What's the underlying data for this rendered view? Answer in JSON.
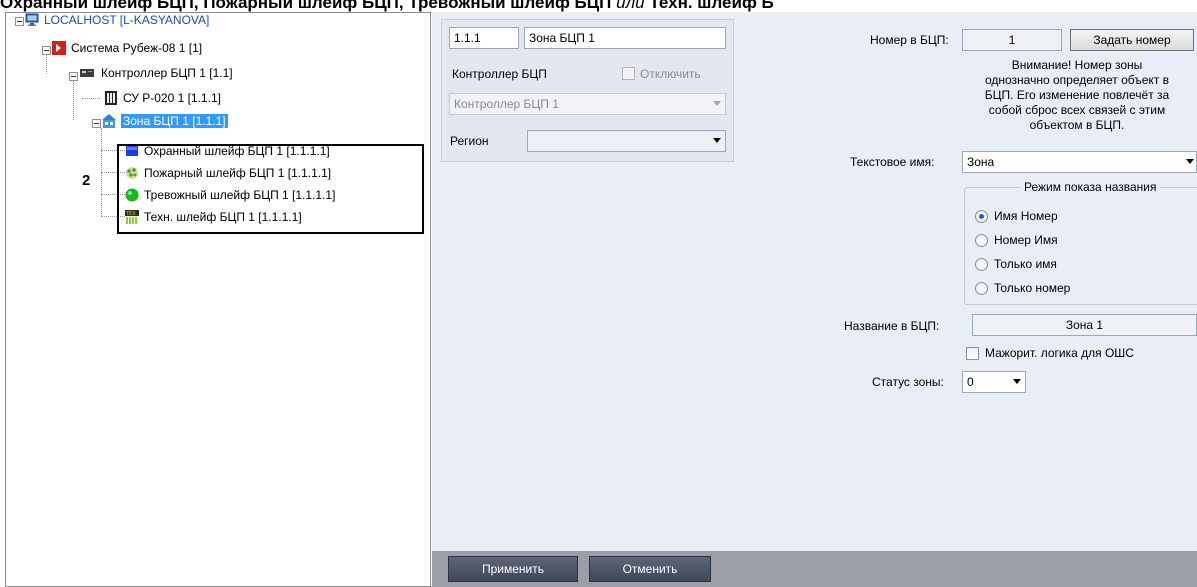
{
  "heading": {
    "part1": "Охранный шлейф БЦП",
    "sep1": ", ",
    "part2": "Пожарный шлейф БЦП",
    "sep2": ", ",
    "part3": "Тревожный шлейф БЦП",
    "sep3": " или ",
    "part4": "Техн. шлейф Б"
  },
  "tree": {
    "root": "LOCALHOST [L-KASYANOVA]",
    "system": "Система Рубеж-08 1 [1]",
    "controller": "Контроллер БЦП 1 [1.1]",
    "su": "СУ Р-020 1 [1.1.1]",
    "zone": "Зона БЦП 1 [1.1.1]",
    "loops": [
      {
        "label": "Охранный шлейф БЦП 1 [1.1.1.1]",
        "icon": "security-loop-icon"
      },
      {
        "label": "Пожарный шлейф БЦП 1 [1.1.1.1]",
        "icon": "fire-loop-icon"
      },
      {
        "label": "Тревожный шлейф БЦП 1 [1.1.1.1]",
        "icon": "alarm-loop-icon"
      },
      {
        "label": "Техн. шлейф БЦП 1 [1.1.1.1]",
        "icon": "tech-loop-icon"
      }
    ],
    "annotation": "2"
  },
  "form": {
    "id_value": "1.1.1",
    "name_value": "Зона БЦП 1",
    "controller_label": "Контроллер БЦП",
    "disable_label": "Отключить",
    "controller_value": "Контроллер БЦП 1",
    "region_label": "Регион",
    "region_value": "",
    "number_label": "Номер в БЦП:",
    "number_value": "1",
    "set_number_button": "Задать номер",
    "warning": [
      "Внимание! Номер зоны",
      "однозначно определяет объект в",
      "БЦП. Его изменение повлечёт за",
      "собой сброс всех связей с этим",
      "объектом в БЦП."
    ],
    "text_name_label": "Текстовое имя:",
    "text_name_value": "Зона",
    "display_mode_title": "Режим показа названия",
    "display_modes": [
      "Имя Номер",
      "Номер Имя",
      "Только имя",
      "Только номер"
    ],
    "selected_mode": "Имя Номер",
    "bcp_name_label": "Название в БЦП:",
    "bcp_name_value": "Зона 1",
    "majority_label": "Мажорит. логика для ОШС",
    "zone_status_label": "Статус зоны:",
    "zone_status_value": "0",
    "apply_button": "Применить",
    "cancel_button": "Отменить"
  },
  "colors": {
    "selection": "#3399ff",
    "form_bg": "#e8edf6",
    "footer_bg": "#9c9ea7",
    "root_text": "#1d4fa8"
  }
}
